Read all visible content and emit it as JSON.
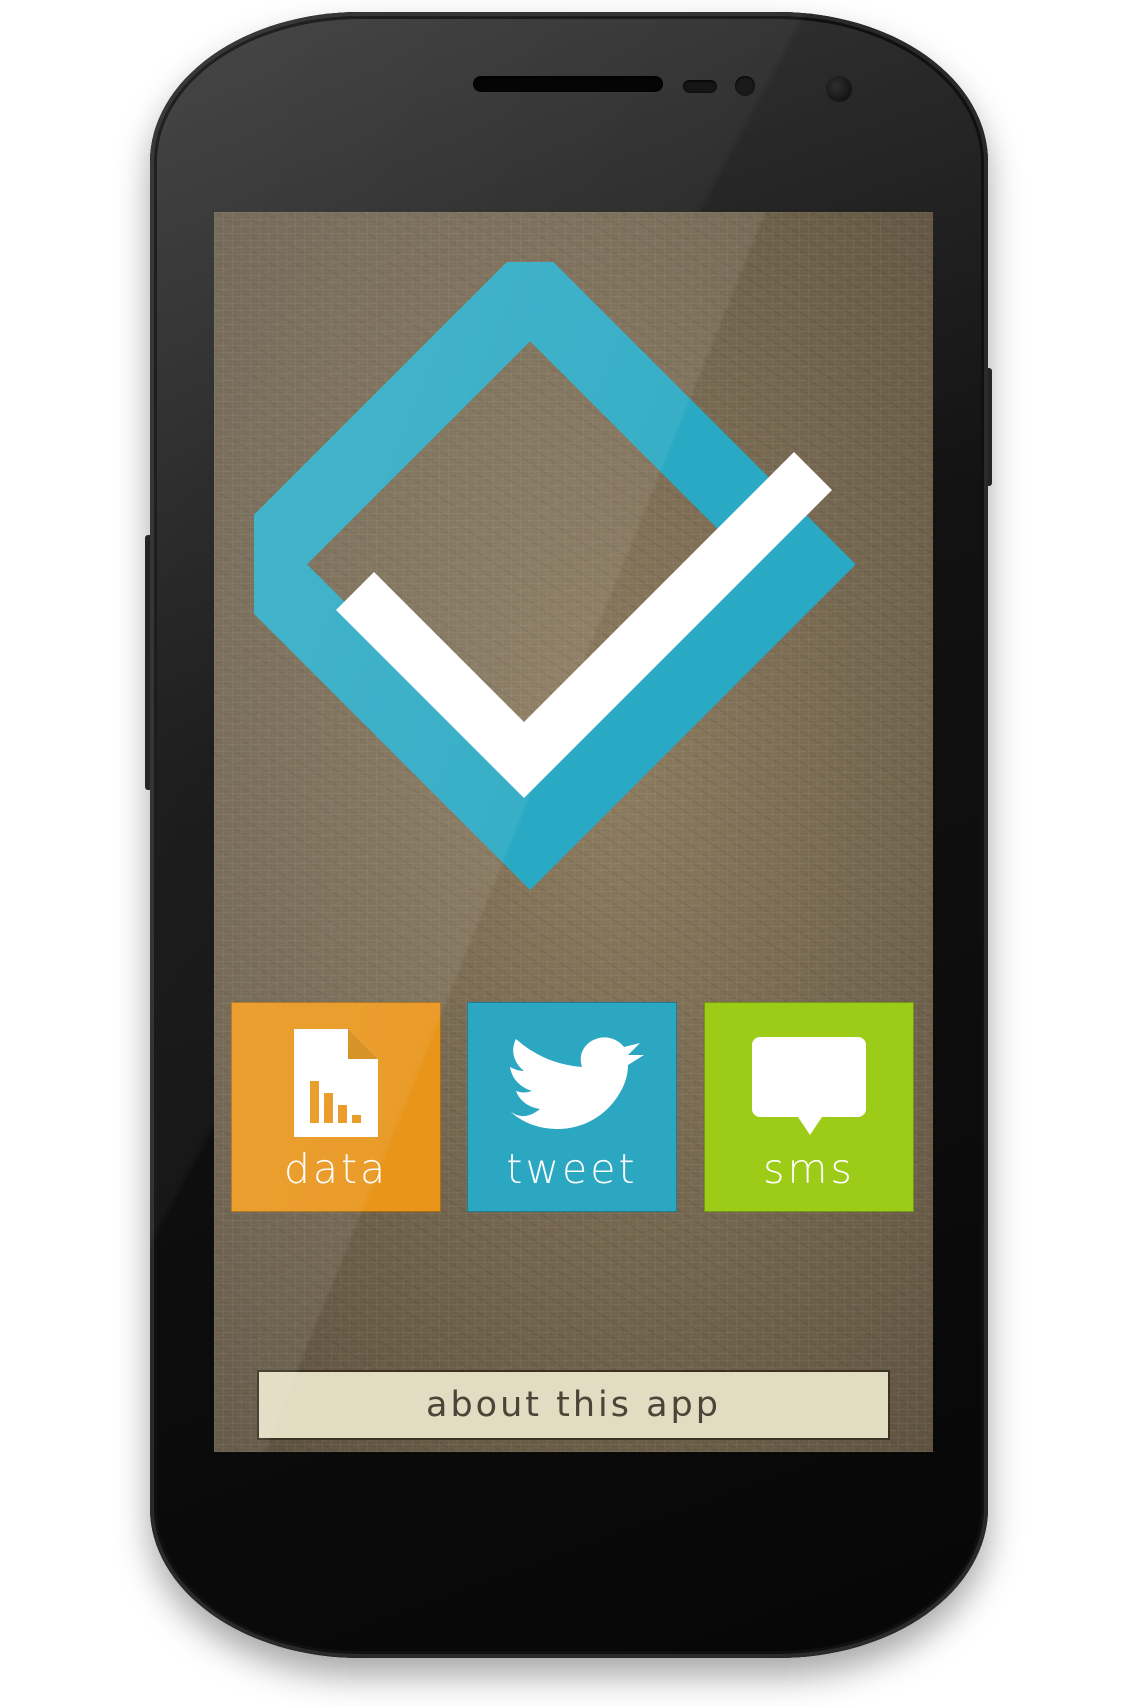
{
  "tiles": [
    {
      "label": "data",
      "icon": "data-file-chart-icon",
      "color": "#e8951a"
    },
    {
      "label": "tweet",
      "icon": "twitter-bird-icon",
      "color": "#2ba7c2"
    },
    {
      "label": "sms",
      "icon": "speech-bubble-icon",
      "color": "#9ccc18"
    }
  ],
  "about_button": {
    "label": "about this app"
  },
  "colors": {
    "logo_frame": "#29a9c3",
    "checkmark": "#ffffff",
    "about_bg": "#e2dcc3"
  }
}
